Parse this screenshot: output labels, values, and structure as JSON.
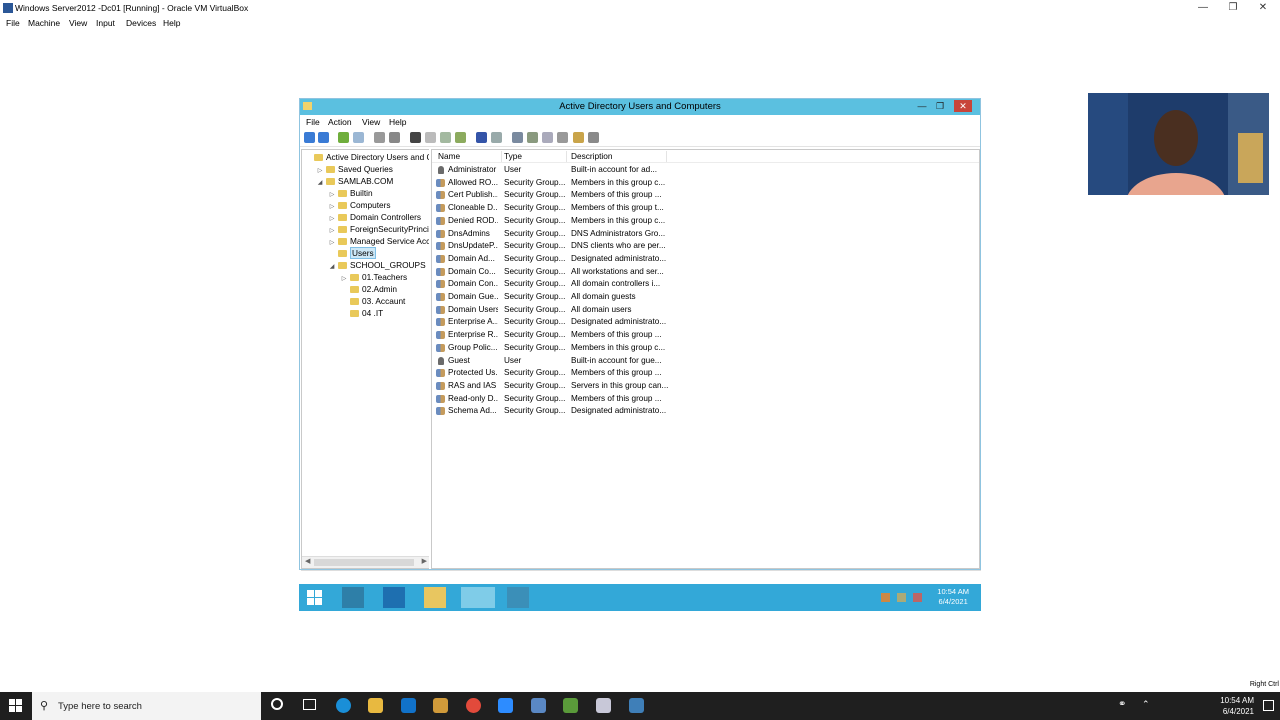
{
  "host": {
    "window_title": "Windows Server2012 -Dc01 [Running] - Oracle VM VirtualBox",
    "menu": [
      "File",
      "Machine",
      "View",
      "Input",
      "Devices",
      "Help"
    ],
    "search_placeholder": "Type here to search",
    "time": "10:54 AM",
    "date": "6/4/2021",
    "host_key": "Right Ctrl"
  },
  "guest": {
    "window_title": "Active Directory Users and Computers",
    "menu": [
      "File",
      "Action",
      "View",
      "Help"
    ],
    "tree": [
      {
        "label": "Active Directory Users and Com",
        "level": 0,
        "expander": ""
      },
      {
        "label": "Saved Queries",
        "level": 1,
        "expander": "▷"
      },
      {
        "label": "SAMLAB.COM",
        "level": 1,
        "expander": "◢"
      },
      {
        "label": "Builtin",
        "level": 2,
        "expander": "▷"
      },
      {
        "label": "Computers",
        "level": 2,
        "expander": "▷"
      },
      {
        "label": "Domain Controllers",
        "level": 2,
        "expander": "▷"
      },
      {
        "label": "ForeignSecurityPrincipals",
        "level": 2,
        "expander": "▷"
      },
      {
        "label": "Managed Service Accour",
        "level": 2,
        "expander": "▷"
      },
      {
        "label": "Users",
        "level": 2,
        "expander": "",
        "selected": true
      },
      {
        "label": "SCHOOL_GROUPS",
        "level": 2,
        "expander": "◢"
      },
      {
        "label": "01.Teachers",
        "level": 3,
        "expander": "▷"
      },
      {
        "label": "02.Admin",
        "level": 3,
        "expander": ""
      },
      {
        "label": "03. Accaunt",
        "level": 3,
        "expander": ""
      },
      {
        "label": "04 .IT",
        "level": 3,
        "expander": ""
      }
    ],
    "columns": [
      "Name",
      "Type",
      "Description"
    ],
    "rows": [
      {
        "name": "Administrator",
        "type": "User",
        "desc": "Built-in account for ad...",
        "icon": "user"
      },
      {
        "name": "Allowed RO...",
        "type": "Security Group...",
        "desc": "Members in this group c...",
        "icon": "group"
      },
      {
        "name": "Cert Publish...",
        "type": "Security Group...",
        "desc": "Members of this group ...",
        "icon": "group"
      },
      {
        "name": "Cloneable D...",
        "type": "Security Group...",
        "desc": "Members of this group t...",
        "icon": "group"
      },
      {
        "name": "Denied ROD...",
        "type": "Security Group...",
        "desc": "Members in this group c...",
        "icon": "group"
      },
      {
        "name": "DnsAdmins",
        "type": "Security Group...",
        "desc": "DNS Administrators Gro...",
        "icon": "group"
      },
      {
        "name": "DnsUpdateP...",
        "type": "Security Group...",
        "desc": "DNS clients who are per...",
        "icon": "group"
      },
      {
        "name": "Domain Ad...",
        "type": "Security Group...",
        "desc": "Designated administrato...",
        "icon": "group"
      },
      {
        "name": "Domain Co...",
        "type": "Security Group...",
        "desc": "All workstations and ser...",
        "icon": "group"
      },
      {
        "name": "Domain Con...",
        "type": "Security Group...",
        "desc": "All domain controllers i...",
        "icon": "group"
      },
      {
        "name": "Domain Gue...",
        "type": "Security Group...",
        "desc": "All domain guests",
        "icon": "group"
      },
      {
        "name": "Domain Users",
        "type": "Security Group...",
        "desc": "All domain users",
        "icon": "group"
      },
      {
        "name": "Enterprise A...",
        "type": "Security Group...",
        "desc": "Designated administrato...",
        "icon": "group"
      },
      {
        "name": "Enterprise R...",
        "type": "Security Group...",
        "desc": "Members of this group ...",
        "icon": "group"
      },
      {
        "name": "Group Polic...",
        "type": "Security Group...",
        "desc": "Members in this group c...",
        "icon": "group"
      },
      {
        "name": "Guest",
        "type": "User",
        "desc": "Built-in account for gue...",
        "icon": "user"
      },
      {
        "name": "Protected Us...",
        "type": "Security Group...",
        "desc": "Members of this group ...",
        "icon": "group"
      },
      {
        "name": "RAS and IAS ...",
        "type": "Security Group...",
        "desc": "Servers in this group can...",
        "icon": "group"
      },
      {
        "name": "Read-only D...",
        "type": "Security Group...",
        "desc": "Members of this group ...",
        "icon": "group"
      },
      {
        "name": "Schema Ad...",
        "type": "Security Group...",
        "desc": "Designated administrato...",
        "icon": "group"
      }
    ],
    "time": "10:54 AM",
    "date": "6/4/2021"
  }
}
